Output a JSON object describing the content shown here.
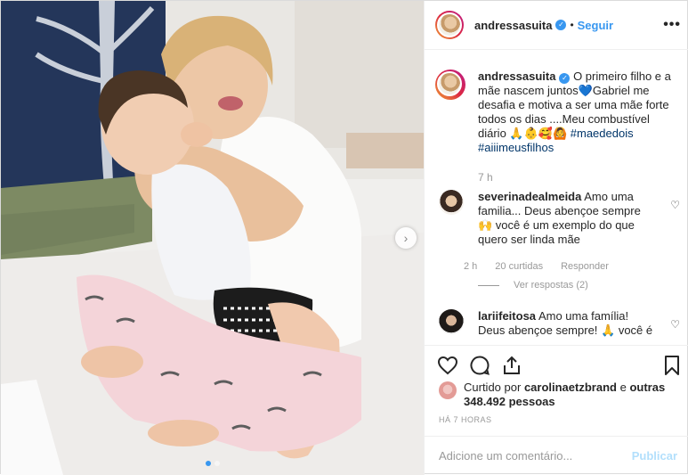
{
  "header": {
    "username": "andressasuita",
    "separator": "•",
    "follow_label": "Seguir",
    "more_label": "•••"
  },
  "caption": {
    "username": "andressasuita",
    "text_part1": "O primeiro filho e a mãe nascem juntos",
    "heart_emoji": "💙",
    "text_part2": "Gabriel me desafia e motiva a ser uma mãe forte todos os dias ....Meu combustível diário 🙏👶🥰🙆 ",
    "hashtag1": "#maededois",
    "hashtag2": "#aiiimeusfilhos",
    "time": "7 h"
  },
  "comments": [
    {
      "username": "severinadealmeida",
      "text": "Amo uma familia... Deus abençoe sempre 🙌 você é um exemplo do que quero ser linda mãe",
      "time": "2 h",
      "likes": "20 curtidas",
      "reply_label": "Responder",
      "view_replies": "Ver respostas (2)"
    },
    {
      "username": "lariifeitosa",
      "text": "Amo uma família! Deus abençoe sempre! 🙏 você é"
    }
  ],
  "likes": {
    "prefix": "Curtido por",
    "user": "carolinaetzbrand",
    "middle": "e",
    "others": "outras 348.492 pessoas"
  },
  "posted_ago": "HÁ 7 HORAS",
  "add_comment": {
    "placeholder": "Adicione um comentário...",
    "publish_label": "Publicar"
  },
  "carousel": {
    "next_arrow": "›",
    "slides": 2,
    "active_slide": 1
  },
  "icons": [
    "more-icon",
    "verified-icon",
    "heart-icon",
    "comment-icon",
    "share-icon",
    "bookmark-icon",
    "chevron-right-icon"
  ],
  "colors": {
    "accent": "#3897f0",
    "hashtag": "#003569",
    "muted": "#999999",
    "publish_disabled": "#b2dffc"
  }
}
